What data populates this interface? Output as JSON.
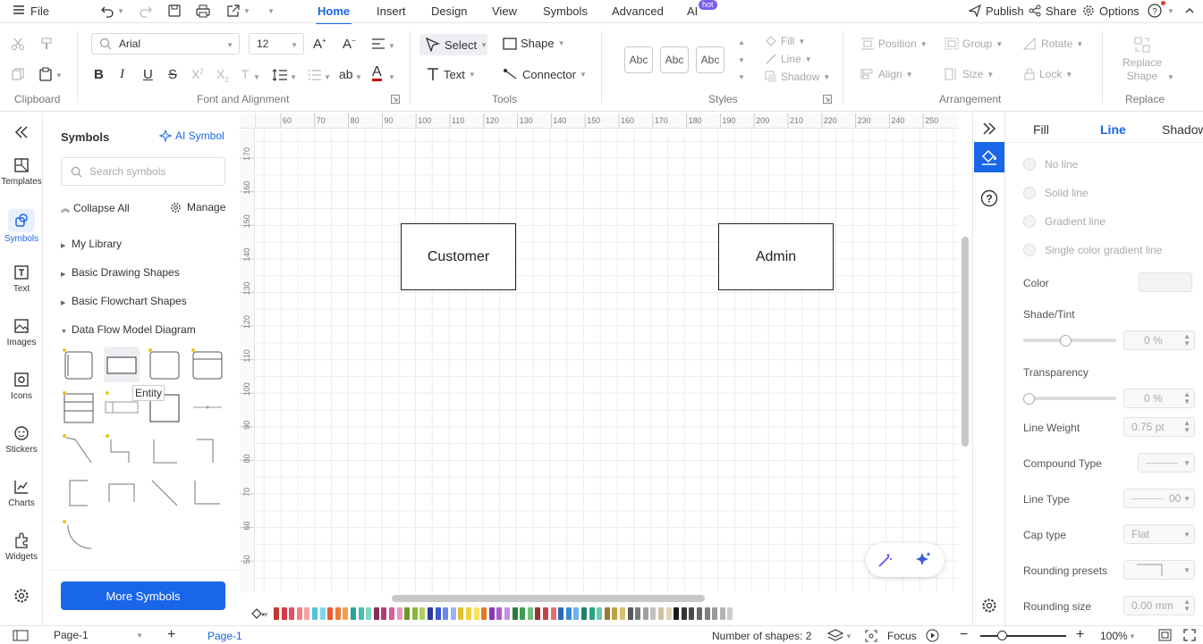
{
  "menu": {
    "file": "File",
    "tabs": [
      "Home",
      "Insert",
      "Design",
      "View",
      "Symbols",
      "Advanced",
      "AI"
    ],
    "active_tab": "Home",
    "hot_badge": "hot",
    "publish": "Publish",
    "share": "Share",
    "options": "Options"
  },
  "ribbon": {
    "font_family": "Arial",
    "font_size": "12",
    "select": "Select",
    "shape": "Shape",
    "text": "Text",
    "connector": "Connector",
    "style_samples": [
      "Abc",
      "Abc",
      "Abc"
    ],
    "fill": "Fill",
    "line": "Line",
    "shadow": "Shadow",
    "position": "Position",
    "group": "Group",
    "rotate": "Rotate",
    "align": "Align",
    "size": "Size",
    "lock": "Lock",
    "replace_shape": "Replace Shape",
    "groups": {
      "clipboard": "Clipboard",
      "font": "Font and Alignment",
      "tools": "Tools",
      "styles": "Styles",
      "arrangement": "Arrangement",
      "replace": "Replace"
    }
  },
  "rail": [
    "Templates",
    "Symbols",
    "Text",
    "Images",
    "Icons",
    "Stickers",
    "Charts",
    "Widgets"
  ],
  "symbols": {
    "title": "Symbols",
    "ai_symbol": "AI Symbol",
    "search_placeholder": "Search symbols",
    "collapse_all": "Collapse All",
    "manage": "Manage",
    "tree": [
      "My Library",
      "Basic Drawing Shapes",
      "Basic Flowchart Shapes",
      "Data Flow Model Diagram"
    ],
    "tooltip": "Entity",
    "more_symbols": "More Symbols"
  },
  "ruler": {
    "h_ticks": [
      "60",
      "70",
      "80",
      "90",
      "100",
      "110",
      "120",
      "130",
      "140",
      "150",
      "160",
      "170",
      "180",
      "190",
      "200",
      "210",
      "220",
      "230",
      "240",
      "250"
    ],
    "v_ticks": [
      "170",
      "160",
      "150",
      "140",
      "130",
      "120",
      "110",
      "100",
      "90",
      "80",
      "70",
      "60",
      "50"
    ]
  },
  "canvas": {
    "shapes": [
      {
        "label": "Customer"
      },
      {
        "label": "Admin"
      }
    ]
  },
  "palette_colors": [
    "#c0392b",
    "#d63a4a",
    "#e84c6b",
    "#f08080",
    "#f4a0a8",
    "#4fc3d9",
    "#7fd6e6",
    "#e65c2e",
    "#f07c3a",
    "#f5a04a",
    "#2aa39a",
    "#46bfae",
    "#7fd8c8",
    "#8e2a5a",
    "#b03a78",
    "#d060a0",
    "#e898c0",
    "#6a9a2a",
    "#8bb83a",
    "#b0d060",
    "#2a3a9a",
    "#3a5ad0",
    "#6a8af0",
    "#9ab0f8",
    "#e0c030",
    "#f0d040",
    "#f8e060",
    "#e07a20",
    "#8a3ab0",
    "#a860d0",
    "#c890e8",
    "#2a7a3a",
    "#3aa050",
    "#70c080",
    "#a03030",
    "#c04848",
    "#e07070",
    "#2a6ab0",
    "#3a8ad8",
    "#70b0f0",
    "#20806a",
    "#30a088",
    "#70c8b0",
    "#9a7a30",
    "#c0a040",
    "#d8c070",
    "#5a5a5a",
    "#7a7a7a",
    "#a0a0a0",
    "#c0c0c0",
    "#d0c0a0",
    "#e0d4b8",
    "#1a1a1a",
    "#333333",
    "#4a4a4a",
    "#666666",
    "#808080",
    "#999999",
    "#b3b3b3",
    "#cccccc"
  ],
  "props": {
    "tabs": [
      "Fill",
      "Line",
      "Shadow"
    ],
    "active_tab": "Line",
    "line_options": [
      "No line",
      "Solid line",
      "Gradient line",
      "Single color gradient line"
    ],
    "color_label": "Color",
    "shade_label": "Shade/Tint",
    "shade_value": "0 %",
    "shade_level": 0.45,
    "transparency_label": "Transparency",
    "transparency_value": "0 %",
    "transparency_level": 0.0,
    "line_weight_label": "Line Weight",
    "line_weight_value": "0.75 pt",
    "compound_label": "Compound Type",
    "line_type_label": "Line Type",
    "line_type_value": "00",
    "cap_label": "Cap type",
    "cap_value": "Flat",
    "rounding_presets_label": "Rounding presets",
    "rounding_size_label": "Rounding size",
    "rounding_size_value": "0.00 mm"
  },
  "status": {
    "page_select": "Page-1",
    "page_tab": "Page-1",
    "shape_count": "Number of shapes: 2",
    "focus": "Focus",
    "zoom": "100%"
  }
}
